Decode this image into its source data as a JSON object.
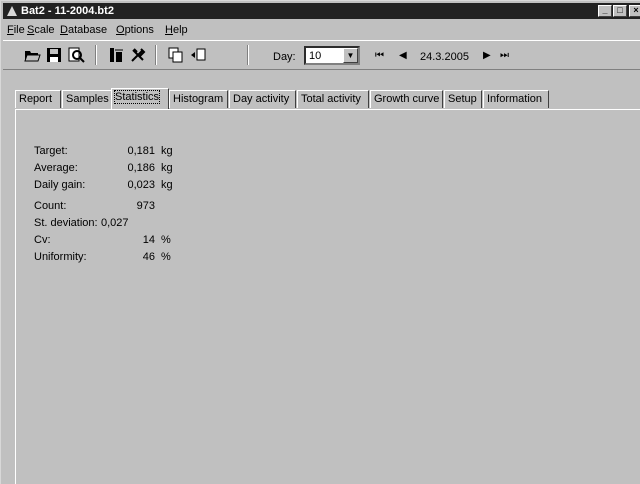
{
  "window": {
    "title": "Bat2 - 11-2004.bt2",
    "buttons": [
      "_",
      "□",
      "×"
    ]
  },
  "menu": [
    {
      "u": "F",
      "rest": "ile"
    },
    {
      "u": "S",
      "rest": "cale"
    },
    {
      "u": "D",
      "rest": "atabase"
    },
    {
      "u": "O",
      "rest": "ptions"
    },
    {
      "u": "H",
      "rest": "elp"
    }
  ],
  "toolbar": {
    "icons": [
      "open-icon",
      "save-icon",
      "print-preview-icon",
      "scale-icon",
      "tools-icon",
      "copy-icon",
      "paste-icon"
    ],
    "day_label": "Day:",
    "day_value": "10",
    "date": "24.3.2005",
    "nav_first": "⏮",
    "nav_prev": "◀",
    "nav_next": "▶",
    "nav_last": "⏭"
  },
  "tabs": [
    "Report",
    "Samples",
    "Statistics",
    "Histogram",
    "Day activity",
    "Total activity",
    "Growth curve",
    "Setup",
    "Information"
  ],
  "active_tab": "Statistics",
  "statistics": {
    "target": {
      "label": "Target:",
      "value": "0,181",
      "unit": "kg"
    },
    "average": {
      "label": "Average:",
      "value": "0,186",
      "unit": "kg"
    },
    "daily_gain": {
      "label": "Daily gain:",
      "value": "0,023",
      "unit": "kg"
    },
    "count": {
      "label": "Count:",
      "value": "973",
      "unit": ""
    },
    "st_deviation": {
      "label": "St. deviation:",
      "value": "0,027",
      "unit": ""
    },
    "cv": {
      "label": "Cv:",
      "value": "14",
      "unit": "%"
    },
    "uniformity": {
      "label": "Uniformity:",
      "value": "46",
      "unit": "%"
    }
  }
}
